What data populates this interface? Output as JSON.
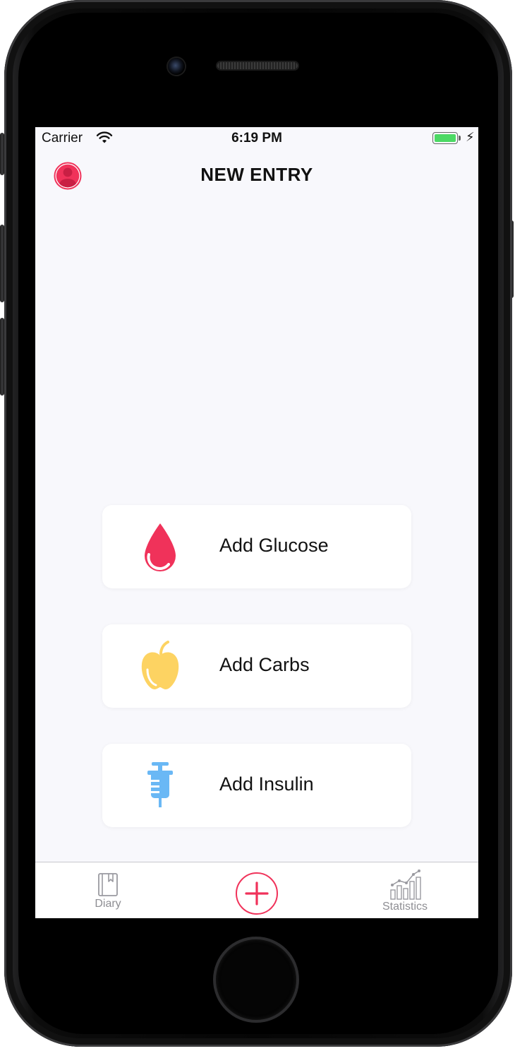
{
  "status_bar": {
    "carrier": "Carrier",
    "time": "6:19 PM",
    "battery_color": "#4cd964"
  },
  "nav": {
    "title": "NEW ENTRY",
    "profile_icon": "person-circle-icon"
  },
  "entries": [
    {
      "label": "Add Glucose",
      "icon": "blood-drop-icon",
      "color": "#f0325a"
    },
    {
      "label": "Add Carbs",
      "icon": "apple-icon",
      "color": "#fdd362"
    },
    {
      "label": "Add Insulin",
      "icon": "syringe-icon",
      "color": "#6ab8f5"
    }
  ],
  "tabbar": {
    "diary_label": "Diary",
    "diary_icon": "book-icon",
    "add_icon": "plus-circle-icon",
    "add_color": "#f0325a",
    "statistics_label": "Statistics",
    "statistics_icon": "bar-chart-icon"
  }
}
